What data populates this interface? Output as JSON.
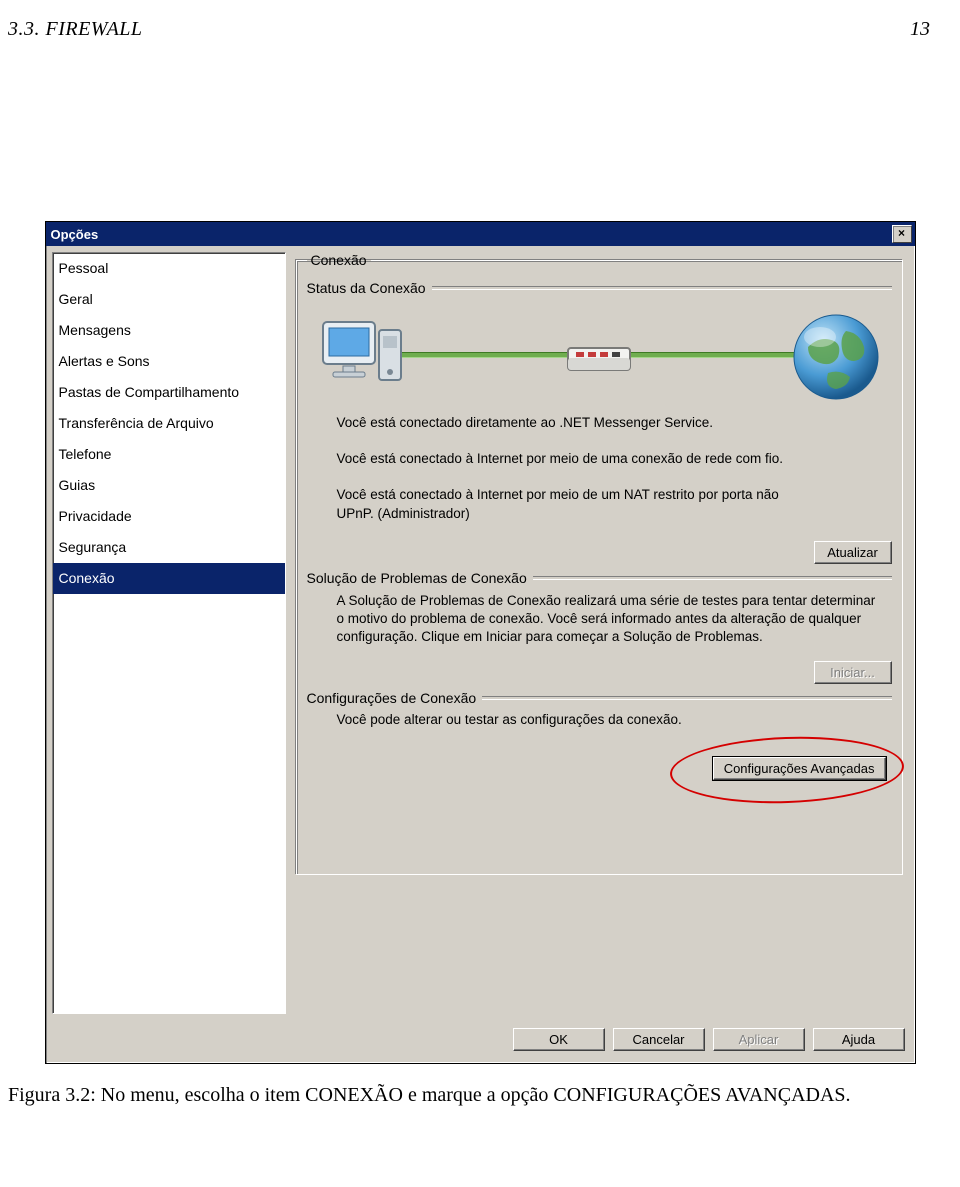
{
  "header": {
    "section": "3.3.  FIREWALL",
    "page": "13"
  },
  "dialog": {
    "title": "Opções",
    "close_glyph": "×",
    "sidebar": {
      "items": [
        {
          "label": "Pessoal"
        },
        {
          "label": "Geral"
        },
        {
          "label": "Mensagens"
        },
        {
          "label": "Alertas e Sons"
        },
        {
          "label": "Pastas de Compartilhamento"
        },
        {
          "label": "Transferência de Arquivo"
        },
        {
          "label": "Telefone"
        },
        {
          "label": "Guias"
        },
        {
          "label": "Privacidade"
        },
        {
          "label": "Segurança"
        },
        {
          "label": "Conexão",
          "selected": true
        }
      ]
    },
    "panel": {
      "title": "Conexão",
      "status": {
        "legend": "Status da Conexão",
        "line1": "Você está conectado diretamente ao .NET Messenger Service.",
        "line2": "Você está conectado à Internet por meio de uma conexão de rede com fio.",
        "line3": "Você está conectado à Internet por meio de um  NAT restrito por porta não UPnP.  (Administrador)",
        "refresh_btn": "Atualizar"
      },
      "troubleshoot": {
        "legend": "Solução de Problemas de Conexão",
        "text": "A Solução de Problemas de Conexão realizará uma série de testes para tentar determinar o motivo do problema de conexão. Você será informado antes da alteração de qualquer configuração. Clique em Iniciar para começar a Solução de Problemas.",
        "start_btn": "Iniciar..."
      },
      "config": {
        "legend": "Configurações de Conexão",
        "text": "Você pode alterar ou testar as configurações da conexão.",
        "advanced_btn": "Configurações Avançadas"
      }
    },
    "buttons": {
      "ok": "OK",
      "cancel": "Cancelar",
      "apply": "Aplicar",
      "help": "Ajuda"
    }
  },
  "caption": "Figura 3.2: No menu, escolha o item CONEXÃO e marque a opção CONFIGURAÇÕES AVANÇADAS."
}
